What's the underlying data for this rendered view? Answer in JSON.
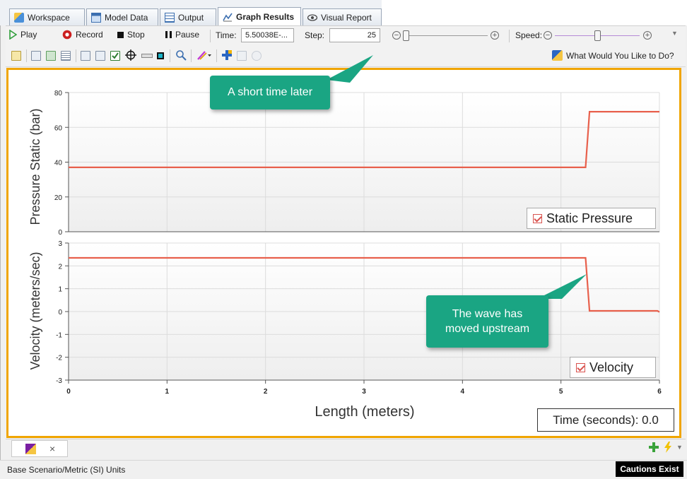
{
  "tabs": [
    {
      "label": "Workspace"
    },
    {
      "label": "Model Data"
    },
    {
      "label": "Output"
    },
    {
      "label": "Graph Results"
    },
    {
      "label": "Visual Report"
    }
  ],
  "toolbar": {
    "play": "Play",
    "record": "Record",
    "stop": "Stop",
    "pause": "Pause",
    "time_label": "Time:",
    "time_value": "5.50038E-...",
    "step_label": "Step:",
    "step_value": "25",
    "speed_label": "Speed:",
    "help_text": "What Would You Like to Do?"
  },
  "callouts": {
    "top": "A short time later",
    "bottom": "The wave has moved upstream"
  },
  "chart_data": [
    {
      "type": "line",
      "ylabel": "Pressure Static (bar)",
      "ylim": [
        0,
        80
      ],
      "yticks": [
        "0",
        "20",
        "40",
        "60",
        "80"
      ],
      "xlim": [
        0,
        6
      ],
      "series": [
        {
          "name": "Static Pressure",
          "color": "#e8604c",
          "x": [
            0,
            5.25,
            5.29,
            6
          ],
          "y": [
            37,
            37,
            69,
            69
          ]
        }
      ],
      "legend": "bottom-right",
      "grid": true
    },
    {
      "type": "line",
      "ylabel": "Velocity (meters/sec)",
      "xlabel": "Length (meters)",
      "ylim": [
        -3,
        3
      ],
      "yticks": [
        "3",
        "2",
        "1",
        "0",
        "-1",
        "-2",
        "-3"
      ],
      "xlim": [
        0,
        6
      ],
      "xticks": [
        "0",
        "1",
        "2",
        "3",
        "4",
        "5",
        "6"
      ],
      "series": [
        {
          "name": "Velocity",
          "color": "#e8604c",
          "x": [
            0,
            5.25,
            5.29,
            5.98,
            6
          ],
          "y": [
            2.35,
            2.35,
            0.03,
            0.03,
            -0.02
          ]
        }
      ],
      "legend": "bottom-right",
      "grid": true
    }
  ],
  "time_box": "Time (seconds): 0.0",
  "status": {
    "scenario": "Base Scenario/Metric (SI) Units",
    "cautions": "Cautions Exist"
  },
  "doc_tab_close": "×"
}
